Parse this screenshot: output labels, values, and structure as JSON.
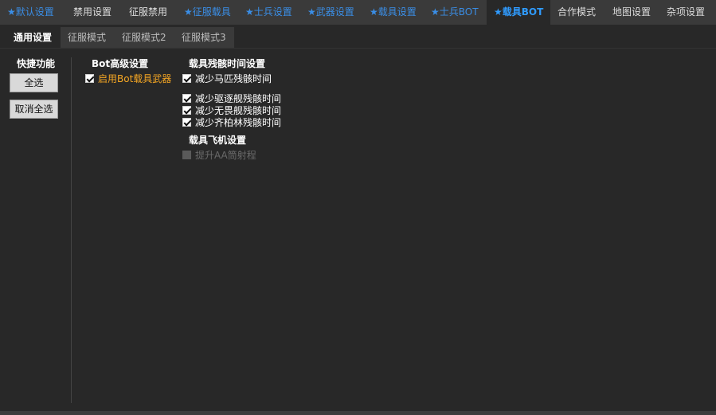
{
  "top_tabs": [
    {
      "label": "★默认设置",
      "starred": true
    },
    {
      "label": "禁用设置",
      "starred": false
    },
    {
      "label": "征服禁用",
      "starred": false
    },
    {
      "label": "★征服载具",
      "starred": true
    },
    {
      "label": "★士兵设置",
      "starred": true
    },
    {
      "label": "★武器设置",
      "starred": true
    },
    {
      "label": "★载具设置",
      "starred": true
    },
    {
      "label": "★士兵BOT",
      "starred": true
    },
    {
      "label": "★载具BOT",
      "starred": true,
      "active": true
    },
    {
      "label": "合作模式",
      "starred": false
    },
    {
      "label": "地图设置",
      "starred": false
    },
    {
      "label": "杂项设置",
      "starred": false
    }
  ],
  "sub_tabs": [
    {
      "label": "通用设置",
      "active": true
    },
    {
      "label": "征服模式"
    },
    {
      "label": "征服模式2"
    },
    {
      "label": "征服模式3"
    }
  ],
  "quick": {
    "title": "快捷功能",
    "select_all": "全选",
    "deselect_all": "取消全选"
  },
  "bot_advanced": {
    "title": "Bot高级设置",
    "enable_bot_vehicle_weapon": {
      "label": "启用Bot载具武器",
      "checked": true
    }
  },
  "wreck_time": {
    "title": "载具残骸时间设置",
    "items": [
      {
        "label": "减少马匹残骸时间",
        "checked": true
      },
      {
        "label": "减少驱逐舰残骸时间",
        "checked": true
      },
      {
        "label": "减少无畏舰残骸时间",
        "checked": true
      },
      {
        "label": "减少齐柏林残骸时间",
        "checked": true
      }
    ]
  },
  "aircraft": {
    "title": "载具飞机设置",
    "aa_range": {
      "label": "提升AA筒射程",
      "checked": false,
      "disabled": true
    }
  },
  "colors": {
    "background": "#282828",
    "tabbar": "#3a3a3a",
    "starred_tab": "#3a8ee6",
    "active_tab": "#2f9bff",
    "orange_label": "#f5a623"
  }
}
